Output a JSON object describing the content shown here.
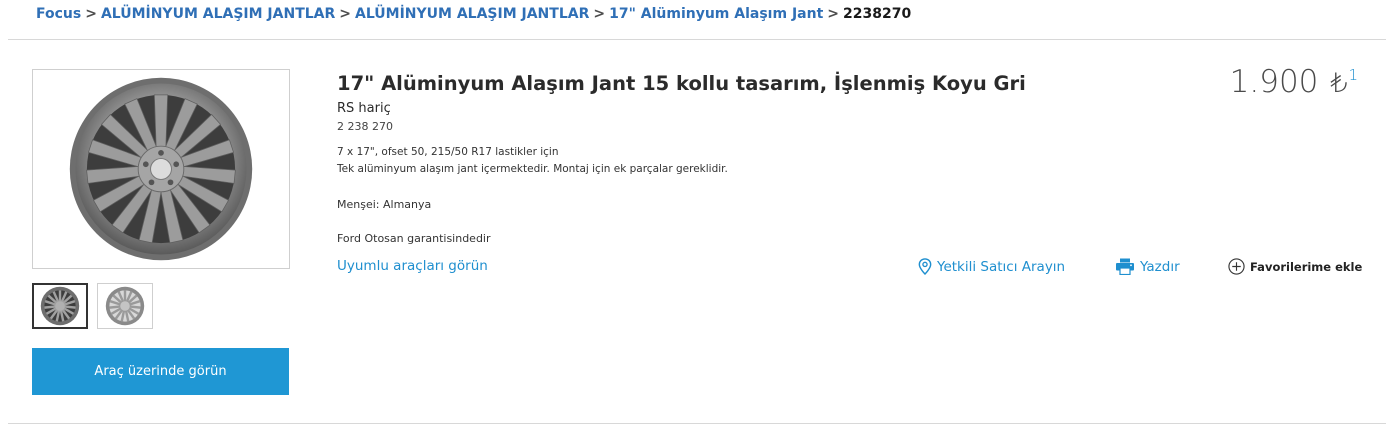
{
  "breadcrumb": {
    "items": [
      "Focus",
      "ALÜMİNYUM ALAŞIM JANTLAR",
      "ALÜMİNYUM ALAŞIM JANTLAR",
      "17\" Alüminyum Alaşım Jant"
    ],
    "separator": ">",
    "current": "2238270"
  },
  "product": {
    "title": "17\" Alüminyum Alaşım Jant 15 kollu tasarım, İşlenmiş Koyu Gri",
    "subtitle": "RS hariç",
    "part_number": "2 238 270",
    "description_lines": [
      "7 x 17\", ofset 50, 215/50 R17 lastikler için",
      "Tek alüminyum alaşım jant içermektedir. Montaj için ek parçalar gereklidir."
    ],
    "origin": "Menşei: Almanya",
    "warranty": "Ford Otosan garantisindedir",
    "compatible_link": "Uyumlu araçları görün"
  },
  "price": {
    "amount": "1.900",
    "currency": "₺",
    "footnote": "1"
  },
  "actions": {
    "dealer": "Yetkili Satıcı Arayın",
    "print": "Yazdır",
    "favorites": "Favorilerime ekle"
  },
  "gallery": {
    "view_on_vehicle": "Araç üzerinde görün"
  },
  "colors": {
    "link_blue": "#1f8fcf",
    "button_blue": "#1f97d4",
    "breadcrumb_blue": "#2f6fb6"
  }
}
